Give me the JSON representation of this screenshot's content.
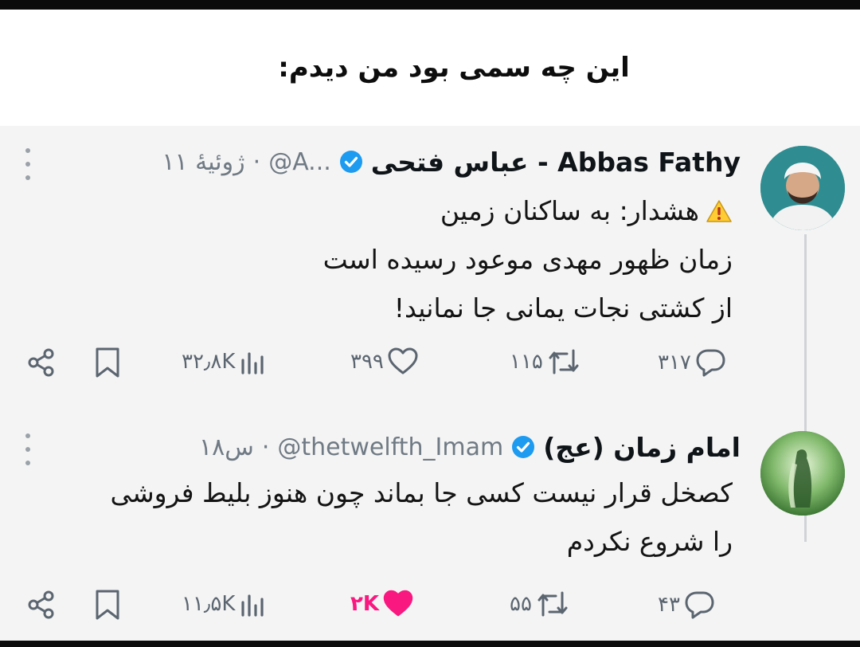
{
  "caption": "این چه سمی بود من دیدم:",
  "colors": {
    "verified": "#1d9bf0",
    "liked": "#f91880",
    "muted": "#5b6570",
    "background": "#f4f4f4"
  },
  "posts": [
    {
      "name": "عباس فتحی - Abbas Fathy",
      "handle": "@A...",
      "meta": "۱۱ ژوئیهٔ",
      "separator": "·",
      "warning_icon": "warning-icon",
      "warning_text": "هشدار: به ساکنان زمین",
      "lines": [
        "زمان ظهور مهدی موعود رسیده است",
        "از کشتی نجات یمانی جا نمانید!"
      ],
      "actions": {
        "replies": "۳۱۷",
        "retweets": "۱۱۵",
        "likes": "۳۹۹",
        "views": "۳۲٫۸K"
      },
      "liked": false
    },
    {
      "name": "امام زمان (عج)",
      "handle": "@thetwelfth_Imam",
      "meta": "۱۸س",
      "separator": "·",
      "lines": [
        "کصخل قرار نیست کسی جا بماند چون هنوز بلیط فروشی",
        "را شروع نکردم"
      ],
      "actions": {
        "replies": "۴۳",
        "retweets": "۵۵",
        "likes": "۲K",
        "views": "۱۱٫۵K"
      },
      "liked": true
    }
  ]
}
